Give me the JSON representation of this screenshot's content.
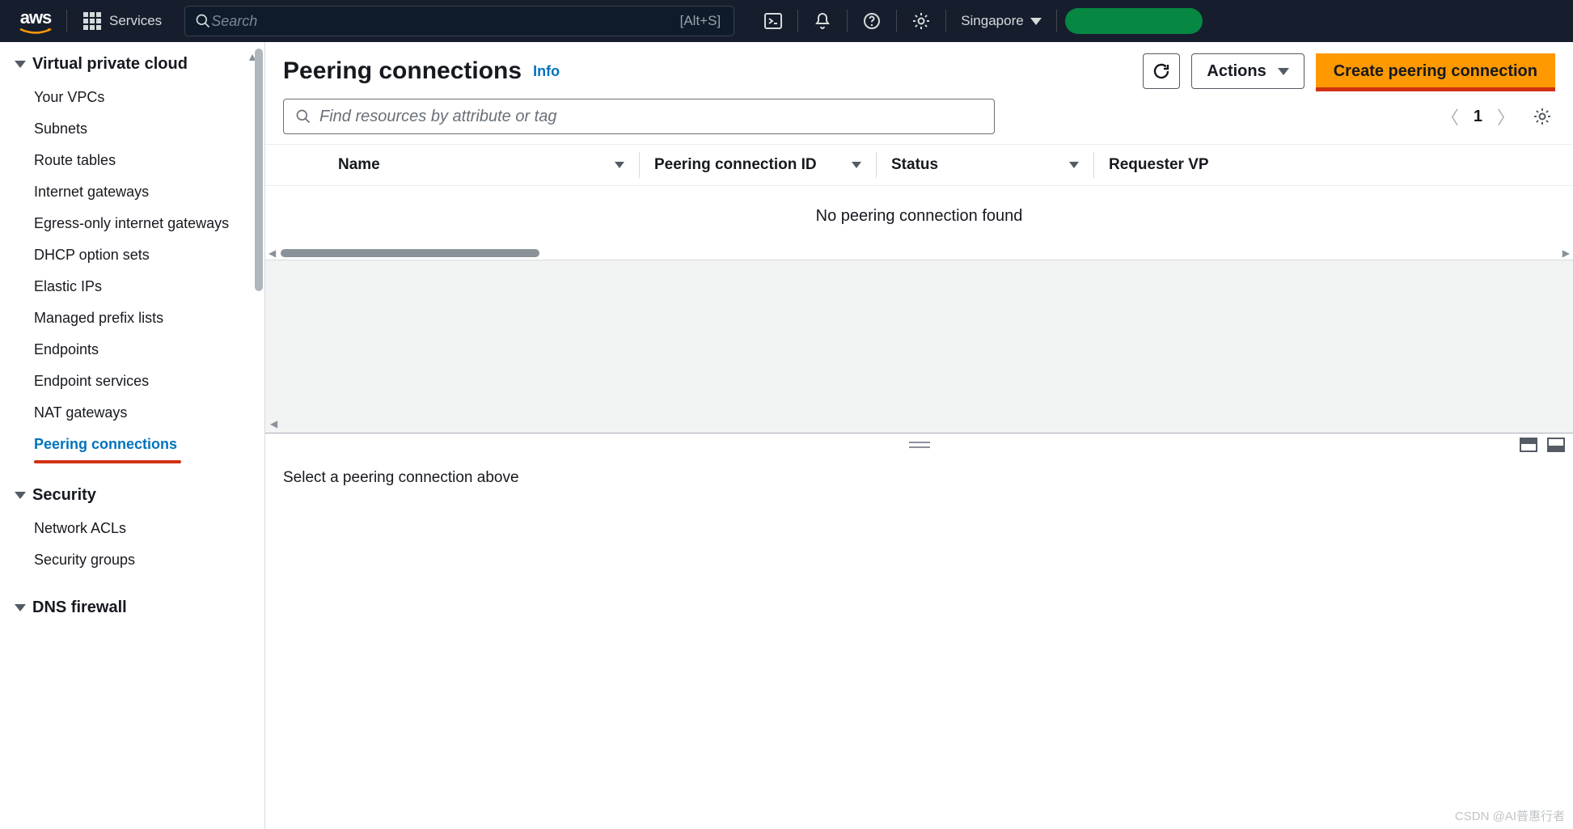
{
  "brand": "aws",
  "nav": {
    "services_label": "Services",
    "search_placeholder": "Search",
    "search_shortcut": "[Alt+S]",
    "region": "Singapore"
  },
  "sidebar": {
    "sections": [
      {
        "title": "Virtual private cloud",
        "items": [
          "Your VPCs",
          "Subnets",
          "Route tables",
          "Internet gateways",
          "Egress-only internet gateways",
          "DHCP option sets",
          "Elastic IPs",
          "Managed prefix lists",
          "Endpoints",
          "Endpoint services",
          "NAT gateways",
          "Peering connections"
        ],
        "active_index": 11
      },
      {
        "title": "Security",
        "items": [
          "Network ACLs",
          "Security groups"
        ]
      },
      {
        "title": "DNS firewall",
        "items": []
      }
    ]
  },
  "page": {
    "title": "Peering connections",
    "info_label": "Info",
    "actions_label": "Actions",
    "create_label": "Create peering connection",
    "filter_placeholder": "Find resources by attribute or tag",
    "page_number": "1",
    "columns": [
      "Name",
      "Peering connection ID",
      "Status",
      "Requester VP"
    ],
    "empty_message": "No peering connection found",
    "detail_prompt": "Select a peering connection above"
  },
  "watermark": "CSDN @AI普惠行者"
}
